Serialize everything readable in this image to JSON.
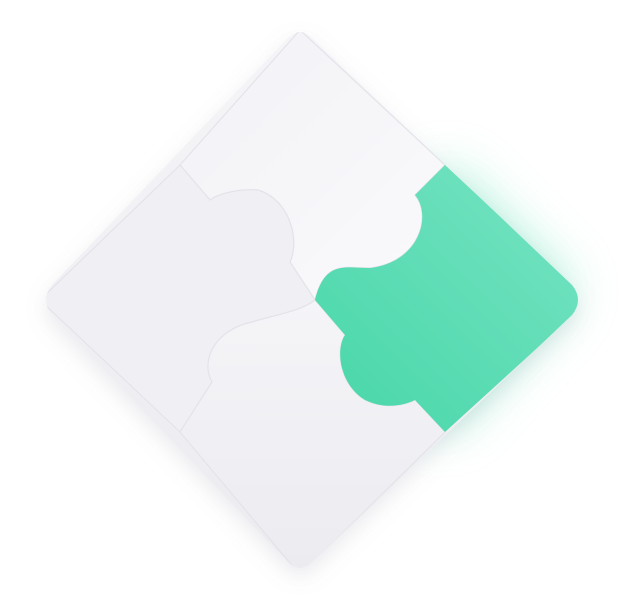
{
  "illustration": {
    "subject": "puzzle-pieces-icon",
    "piece_count": 4,
    "highlighted_piece": "right",
    "colors": {
      "background": "#ffffff",
      "piece_light_top": "#f5f5f8",
      "piece_light_bottom": "#ebebf0",
      "piece_edge": "#e3e3ea",
      "accent_top": "#78e4c3",
      "accent_bottom": "#47d6a8",
      "accent_glow": "#5fe3b6"
    }
  }
}
